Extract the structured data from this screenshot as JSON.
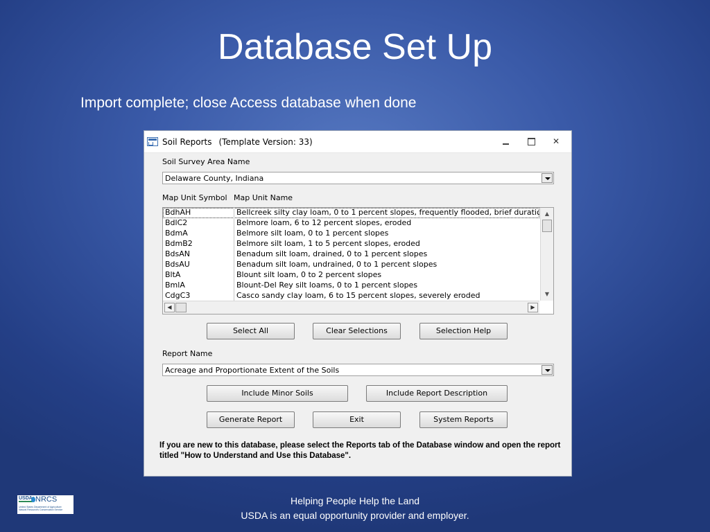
{
  "slide": {
    "title": "Database Set Up",
    "subtitle": "Import complete; close Access database when done"
  },
  "dialog": {
    "title": "Soil Reports",
    "version": "(Template Version: 33)",
    "close_glyph": "✕",
    "survey_area_label": "Soil Survey Area Name",
    "survey_area_value": "Delaware County, Indiana",
    "col_symbol_label": "Map Unit Symbol",
    "col_name_label": "Map Unit Name",
    "map_units": [
      {
        "symbol": "BdhAH",
        "name": "Bellcreek silty clay loam, 0 to 1 percent slopes, frequently flooded, brief duration"
      },
      {
        "symbol": "BdlC2",
        "name": "Belmore loam, 6 to 12 percent slopes, eroded"
      },
      {
        "symbol": "BdmA",
        "name": "Belmore silt loam, 0 to 1 percent slopes"
      },
      {
        "symbol": "BdmB2",
        "name": "Belmore silt loam, 1 to 5 percent slopes, eroded"
      },
      {
        "symbol": "BdsAN",
        "name": "Benadum silt loam, drained, 0 to 1 percent slopes"
      },
      {
        "symbol": "BdsAU",
        "name": "Benadum silt loam, undrained, 0 to 1 percent slopes"
      },
      {
        "symbol": "BltA",
        "name": "Blount silt loam, 0 to 2 percent slopes"
      },
      {
        "symbol": "BmlA",
        "name": "Blount-Del Rey silt loams, 0 to 1 percent slopes"
      },
      {
        "symbol": "CdgC3",
        "name": "Casco sandy clay loam, 6 to 15 percent slopes, severely eroded"
      }
    ],
    "buttons": {
      "select_all": "Select All",
      "clear_selections": "Clear Selections",
      "selection_help": "Selection Help",
      "include_minor_soils": "Include Minor Soils",
      "include_report_description": "Include Report Description",
      "generate_report": "Generate Report",
      "exit": "Exit",
      "system_reports": "System Reports"
    },
    "report_name_label": "Report Name",
    "report_name_value": "Acreage and Proportionate Extent of the Soils",
    "note": "If you are new to this database, please select the Reports tab of the Database window and open the report titled \"How to Understand and Use this Database\"."
  },
  "footer": {
    "line1": "Helping People Help the Land",
    "line2": "USDA is an equal opportunity provider and employer."
  },
  "logo": {
    "usda": "USDA",
    "nrcs": "NRCS",
    "line1": "United States Department of Agriculture",
    "line2": "Natural Resources Conservation Service"
  },
  "colors": {
    "background": "#3a5aa8",
    "dialog": "#f0f0f0"
  }
}
